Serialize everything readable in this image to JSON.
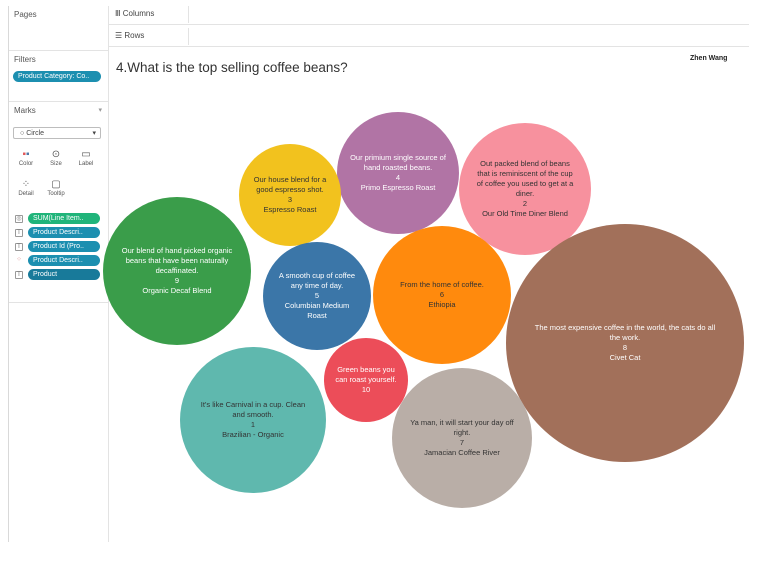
{
  "cards": {
    "pages": "Pages",
    "filters": "Filters",
    "filter_pill": "Product Category: Co..",
    "marks": "Marks",
    "mark_type": "Circle",
    "buttons": [
      "Color",
      "Size",
      "Label",
      "Detail",
      "Tooltip"
    ],
    "mark_pills": [
      "SUM(Line Item..",
      "Product Descri..",
      "Product Id (Pro..",
      "Product Descri..",
      "Product"
    ]
  },
  "shelves": {
    "columns": "Columns",
    "rows": "Rows"
  },
  "view": {
    "title": "4.What is the top selling coffee beans?",
    "author": "Zhen Wang"
  },
  "bubbles": [
    {
      "desc": "Our primium single source of hand roasted beans.",
      "rank": "4",
      "name": "Primo Espresso Roast",
      "color": "#b174a5",
      "text": "#fff"
    },
    {
      "desc": "Out packed blend of beans that is reminiscent of the cup of coffee you used to get at a diner.",
      "rank": "2",
      "name": "Our Old Time Diner Blend",
      "color": "#f7919e",
      "text": "#333"
    },
    {
      "desc": "Our house blend for a good espresso shot.",
      "rank": "3",
      "name": "Espresso Roast",
      "color": "#f2c21e",
      "text": "#333"
    },
    {
      "desc": "Our blend of hand picked organic beans that have been naturally decaffinated.",
      "rank": "9",
      "name": "Organic Decaf Blend",
      "color": "#3a9d4a",
      "text": "#fff"
    },
    {
      "desc": "A smooth cup of coffee any time of day.",
      "rank": "5",
      "name": "Columbian Medium Roast",
      "color": "#3b76a8",
      "text": "#fff"
    },
    {
      "desc": "From the home of coffee.",
      "rank": "6",
      "name": "Ethiopia",
      "color": "#ff8a0d",
      "text": "#333"
    },
    {
      "desc": "The most expensive coffee in the world, the cats do all the work.",
      "rank": "8",
      "name": "Civet Cat",
      "color": "#a2705a",
      "text": "#fff"
    },
    {
      "desc": "It's like Carnival in a cup. Clean and smooth.",
      "rank": "1",
      "name": "Brazilian - Organic",
      "color": "#5fb8ae",
      "text": "#333"
    },
    {
      "desc": "Green beans you can roast yourself.",
      "rank": "10",
      "name": "",
      "color": "#ec4d59",
      "text": "#fff"
    },
    {
      "desc": "Ya man, it will start your day off right.",
      "rank": "7",
      "name": "Jamacian Coffee River",
      "color": "#b9aea7",
      "text": "#333"
    }
  ]
}
